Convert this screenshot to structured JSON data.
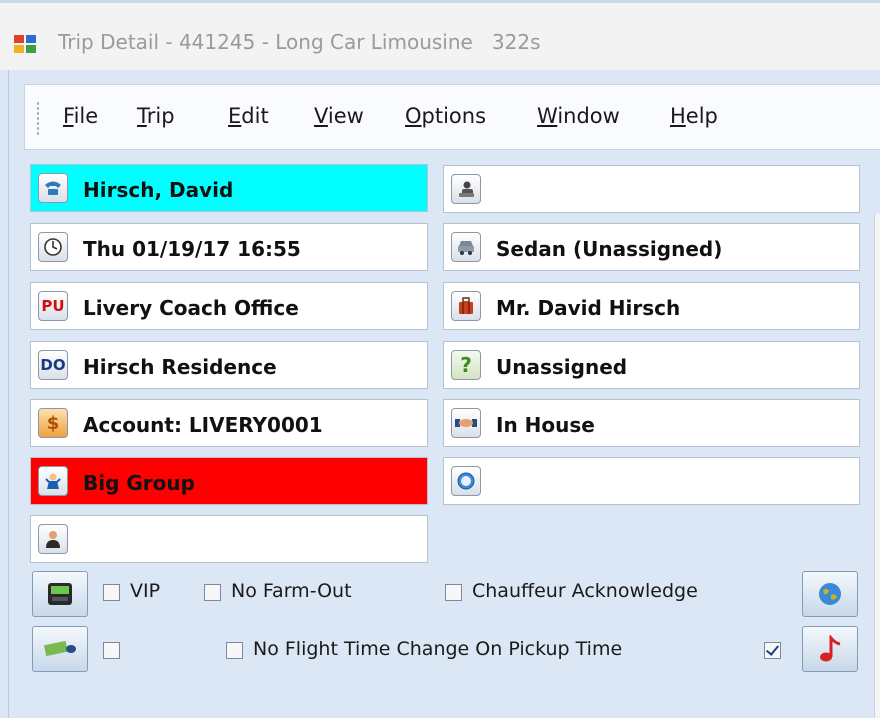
{
  "window": {
    "title": "Trip Detail - 441245 - Long Car Limousine   322s",
    "icon": "app-window-icon"
  },
  "menu": [
    "File",
    "Trip",
    "Edit",
    "View",
    "Options",
    "Window",
    "Help"
  ],
  "left_fields": [
    {
      "icon": "phone-icon",
      "text": "Hirsch, David",
      "bg": "#00ffff"
    },
    {
      "icon": "clock-icon",
      "text": "Thu 01/19/17 16:55"
    },
    {
      "icon": "pickup-icon",
      "icon_text": "PU",
      "text": "Livery Coach Office"
    },
    {
      "icon": "dropoff-icon",
      "icon_text": "DO",
      "text": "Hirsch Residence"
    },
    {
      "icon": "dollar-icon",
      "text": "Account: LIVERY0001"
    },
    {
      "icon": "group-icon",
      "text": "Big Group",
      "bg": "#ff0000"
    },
    {
      "icon": "person-icon",
      "text": ""
    }
  ],
  "right_fields": [
    {
      "icon": "chauffeur-icon",
      "text": ""
    },
    {
      "icon": "car-icon",
      "text": "Sedan (Unassigned)"
    },
    {
      "icon": "luggage-icon",
      "text": "Mr. David Hirsch"
    },
    {
      "icon": "question-icon",
      "icon_text": "?",
      "text": "Unassigned"
    },
    {
      "icon": "handshake-icon",
      "text": "In House"
    },
    {
      "icon": "globe-icon",
      "text": ""
    }
  ],
  "checkboxes": {
    "vip": {
      "label": "VIP",
      "checked": false
    },
    "no_farm_out": {
      "label": "No Farm-Out",
      "checked": false
    },
    "chauffeur_ack": {
      "label": "Chauffeur Acknowledge",
      "checked": false
    },
    "unlabeled": {
      "label": "",
      "checked": false
    },
    "no_flight_time": {
      "label": "No Flight Time Change On Pickup Time",
      "checked": false
    },
    "sound": {
      "label": "",
      "checked": true
    }
  },
  "colors": {
    "highlight_cyan": "#00ffff",
    "alert_red": "#ff0000"
  }
}
